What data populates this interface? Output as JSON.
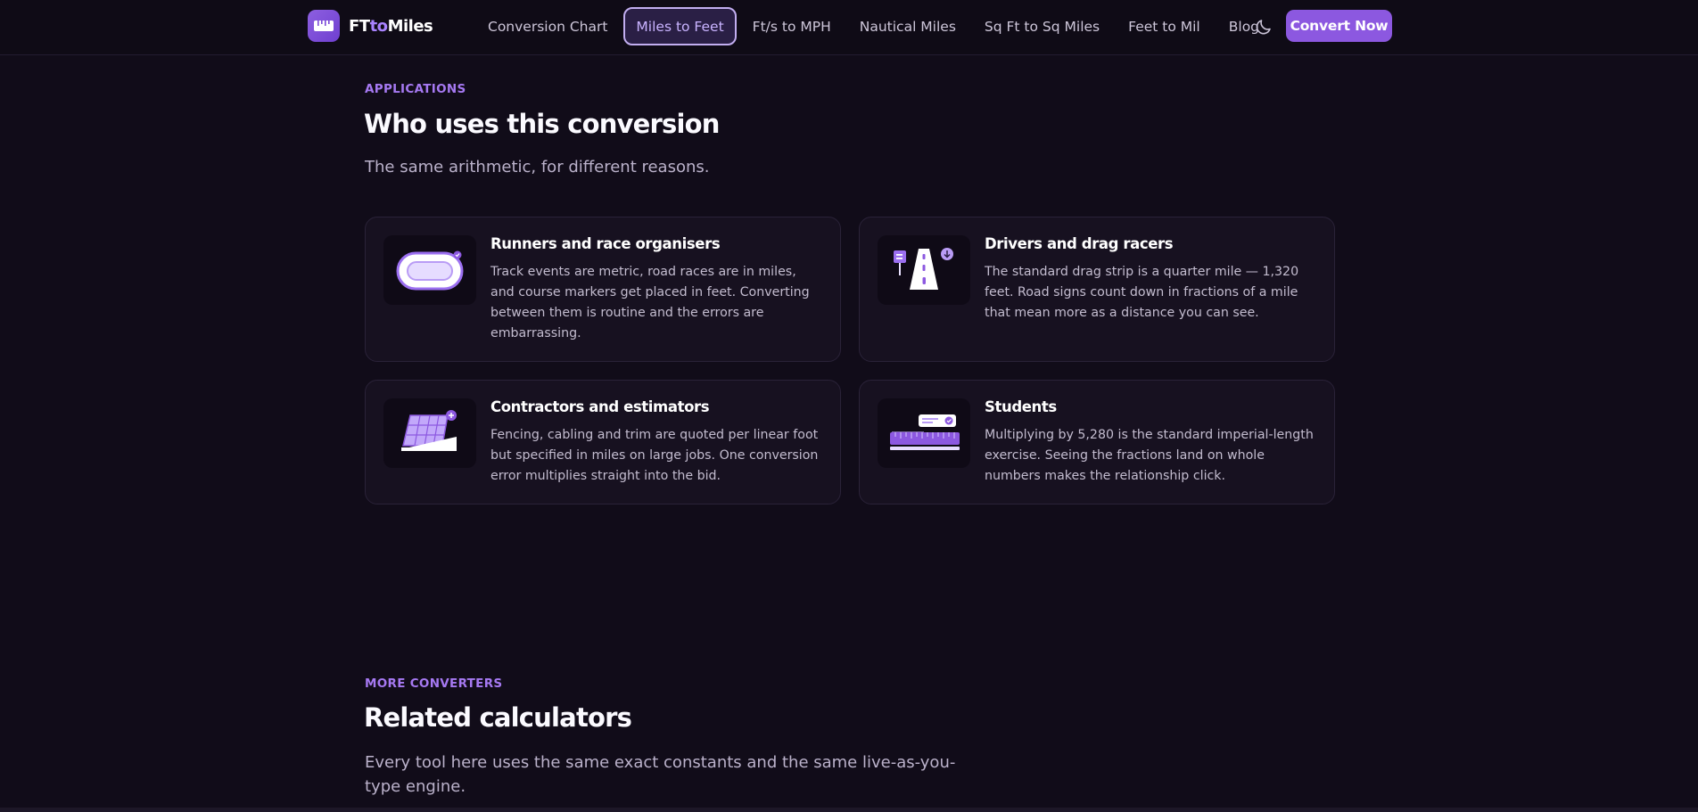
{
  "nav": {
    "brand": {
      "part1": "FT",
      "part2": "to",
      "part3": "Miles"
    },
    "links": [
      {
        "label": "Conversion Chart",
        "active": false
      },
      {
        "label": "Miles to Feet",
        "active": true
      },
      {
        "label": "Ft/s to MPH",
        "active": false
      },
      {
        "label": "Nautical Miles",
        "active": false
      },
      {
        "label": "Sq Ft to Sq Miles",
        "active": false
      },
      {
        "label": "Feet to Mil",
        "active": false
      },
      {
        "label": "Blog",
        "active": false
      }
    ],
    "theme_icon": "moon-icon",
    "cta": "Convert Now"
  },
  "applications": {
    "eyebrow": "APPLICATIONS",
    "title": "Who uses this conversion",
    "lead": "The same arithmetic, for different reasons.",
    "cards": [
      {
        "icon": "race-track-icon",
        "title": "Runners and race organisers",
        "text": "Track events are metric, road races are in miles, and course markers get placed in feet. Converting between them is routine and the errors are embarrassing."
      },
      {
        "icon": "road-icon",
        "title": "Drivers and drag racers",
        "text": "The standard drag strip is a quarter mile — 1,320 feet. Road signs count down in fractions of a mile that mean more as a distance you can see."
      },
      {
        "icon": "fence-grid-icon",
        "title": "Contractors and estimators",
        "text": "Fencing, cabling and trim are quoted per linear foot but specified in miles on large jobs. One conversion error multiplies straight into the bid."
      },
      {
        "icon": "ruler-icon",
        "title": "Students",
        "text": "Multiplying by 5,280 is the standard imperial-length exercise. Seeing the fractions land on whole numbers makes the relationship click."
      }
    ]
  },
  "more": {
    "eyebrow": "MORE CONVERTERS",
    "title": "Related calculators",
    "lead_line1": "Every tool here uses the same exact constants and the same live-as-you-",
    "lead_line2": "type engine."
  },
  "colors": {
    "accent": "#8c58e0",
    "background": "#110c19",
    "card": "#171120",
    "eyebrow": "#a679f2"
  }
}
